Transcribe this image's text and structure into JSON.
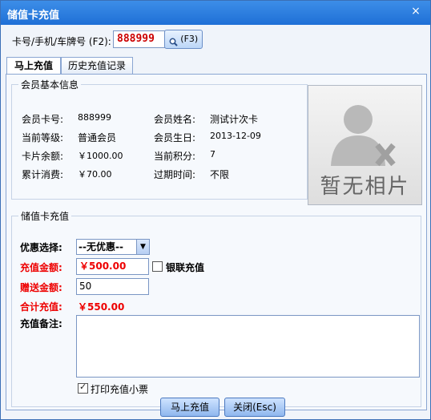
{
  "window": {
    "title": "储值卡充值",
    "close_label": "×"
  },
  "card_search": {
    "label": "卡号/手机/车牌号 (F2):",
    "value": "888999",
    "button_label": "(F3)"
  },
  "tabs": [
    {
      "label": "马上充值"
    },
    {
      "label": "历史充值记录"
    }
  ],
  "member_info": {
    "legend": "会员基本信息",
    "card_no_label": "会员卡号:",
    "card_no": "888999",
    "name_label": "会员姓名:",
    "name": "测试计次卡",
    "level_label": "当前等级:",
    "level": "普通会员",
    "birthday_label": "会员生日:",
    "birthday": "2013-12-09",
    "balance_label": "卡片余额:",
    "balance": "￥1000.00",
    "points_label": "当前积分:",
    "points": "7",
    "spent_label": "累计消费:",
    "spent": "￥70.00",
    "expire_label": "过期时间:",
    "expire": "不限"
  },
  "photo": {
    "placeholder": "暂无相片"
  },
  "topup": {
    "legend": "储值卡充值",
    "discount_label": "优惠选择:",
    "discount_value": "--无优惠--",
    "amount_label": "充值金额:",
    "amount_value": "￥500.00",
    "unionpay_label": "银联充值",
    "gift_label": "赠送金额:",
    "gift_value": "50",
    "total_label": "合计充值:",
    "total_value": "￥550.00",
    "remark_label": "充值备注:",
    "print_label": "打印充值小票"
  },
  "buttons": {
    "charge": "马上充值",
    "close": "关闭(Esc)"
  },
  "colors": {
    "titlebar": "#2a7de0",
    "accent_red": "#e00000"
  }
}
